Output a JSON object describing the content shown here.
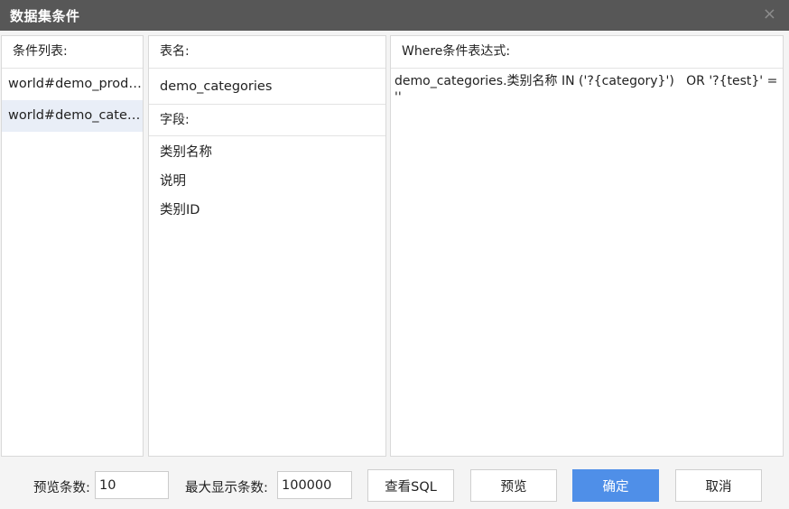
{
  "dialog": {
    "title": "数据集条件",
    "close_glyph": "×"
  },
  "conditions": {
    "header": "条件列表:",
    "items": [
      {
        "label": "world#demo_products"
      },
      {
        "label": "world#demo_categories",
        "selected": true
      }
    ]
  },
  "table": {
    "header": "表名:",
    "name": "demo_categories",
    "fields_header": "字段:",
    "fields": [
      "类别名称",
      "说明",
      "类别ID"
    ]
  },
  "expression": {
    "header": "Where条件表达式:",
    "value": "demo_categories.类别名称 IN ('?{category}')   OR '?{test}' = ''"
  },
  "footer": {
    "preview_rows_label": "预览条数:",
    "preview_rows_value": "10",
    "max_rows_label": "最大显示条数:",
    "max_rows_value": "100000",
    "view_sql_label": "查看SQL",
    "preview_label": "预览",
    "ok_label": "确定",
    "cancel_label": "取消"
  },
  "colors": {
    "titlebar": "#575757",
    "primary": "#4f8fe8",
    "selected_row": "#e9eef7"
  }
}
